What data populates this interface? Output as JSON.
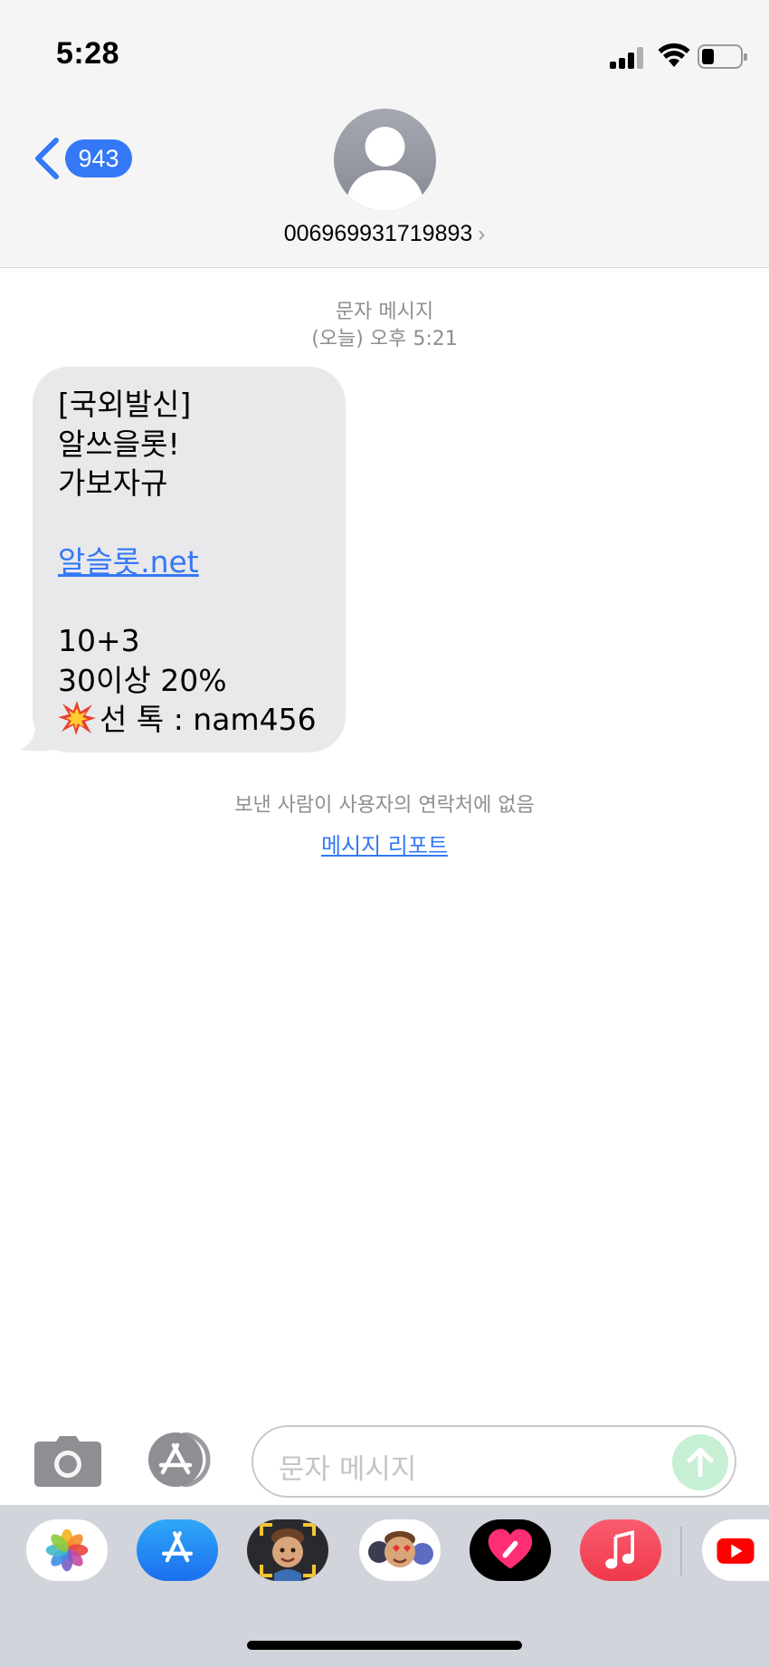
{
  "status_bar": {
    "time": "5:28"
  },
  "header": {
    "back_count": "943",
    "contact_number": "006969931719893",
    "chevron": "›"
  },
  "conversation": {
    "message_type": "문자 메시지",
    "timestamp": "(오늘) 오후 5:21",
    "message": {
      "lines": [
        "[국외발신]",
        "알쓰을롯!",
        "가보자규",
        "",
        "알슬롯.net",
        "",
        "10+3",
        "30이상 20%",
        "선 톡 : nam456"
      ],
      "link_text": "알슬롯.net",
      "emoji": "collision-emoji"
    },
    "sender_notice": "보낸 사람이 사용자의 연락처에 없음",
    "report_link": "메시지 리포트"
  },
  "input_bar": {
    "placeholder": "문자 메시지",
    "send_color": "#c6efd3"
  },
  "app_drawer": {
    "apps": [
      "photos-app-icon",
      "app-store-app-icon",
      "memoji-app-icon",
      "animoji-stickers-app-icon",
      "digital-touch-app-icon",
      "music-app-icon",
      "youtube-app-icon"
    ]
  },
  "colors": {
    "accent": "#3478f6",
    "bubble": "#e9e9eb",
    "header_bg": "#f5f5f5",
    "drawer_bg": "#d1d4da"
  }
}
